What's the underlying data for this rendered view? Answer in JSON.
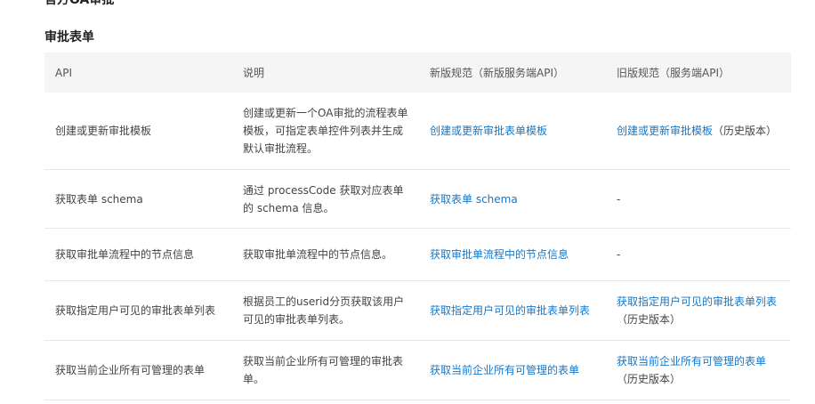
{
  "page": {
    "clipped_heading": "官方OA审批",
    "section_title": "审批表单"
  },
  "table": {
    "headers": [
      "API",
      "说明",
      "新版规范（新版服务端API）",
      "旧版规范（服务端API）"
    ],
    "rows": [
      {
        "api": "创建或更新审批模板",
        "desc": "创建或更新一个OA审批的流程表单模板，可指定表单控件列表并生成默认审批流程。",
        "new_link": "创建或更新审批表单模板",
        "old_link": "创建或更新审批模板",
        "old_note": "（历史版本）"
      },
      {
        "api": "获取表单 schema",
        "desc": "通过 processCode 获取对应表单的 schema 信息。",
        "new_link": "获取表单 schema",
        "old_text": "-"
      },
      {
        "api": "获取审批单流程中的节点信息",
        "desc": "获取审批单流程中的节点信息。",
        "new_link": "获取审批单流程中的节点信息",
        "old_text": "-"
      },
      {
        "api": "获取指定用户可见的审批表单列表",
        "desc": "根据员工的userid分页获取该用户可见的审批表单列表。",
        "new_link": "获取指定用户可见的审批表单列表",
        "old_link": "获取指定用户可见的审批表单列表",
        "old_note": "（历史版本）"
      },
      {
        "api": "获取当前企业所有可管理的表单",
        "desc": "获取当前企业所有可管理的审批表单。",
        "new_link": "获取当前企业所有可管理的表单",
        "old_link": "获取当前企业所有可管理的表单",
        "old_note": "（历史版本）"
      }
    ]
  }
}
